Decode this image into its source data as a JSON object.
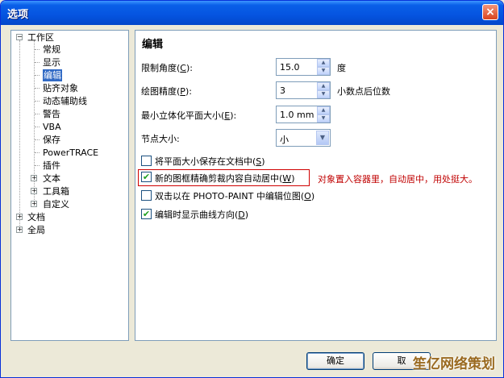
{
  "window": {
    "title": "选项",
    "close_glyph": "×"
  },
  "tree": {
    "workspace": "工作区",
    "workspace_children": [
      "常规",
      "显示",
      "编辑",
      "贴齐对象",
      "动态辅助线",
      "警告",
      "VBA",
      "保存",
      "PowerTRACE",
      "插件"
    ],
    "text": "文本",
    "toolbox": "工具箱",
    "customize": "自定义",
    "document": "文档",
    "global": "全局",
    "selected": "编辑"
  },
  "panel": {
    "heading": "编辑",
    "constrain_angle": {
      "label": "限制角度(",
      "key": "C",
      "label_end": "):",
      "value": "15.0",
      "unit": "度"
    },
    "draw_precision": {
      "label": "绘图精度(",
      "key": "P",
      "label_end": "):",
      "value": "3",
      "unit": "小数点后位数"
    },
    "min_extrude": {
      "label": "最小立体化平面大小(",
      "key": "E",
      "label_end": "):",
      "value": "1.0 mm"
    },
    "node_size": {
      "label": "节点大小:",
      "value": "小"
    },
    "save_face_size": {
      "label": "将平面大小保存在文档中(",
      "key": "S",
      "label_end": ")",
      "checked": false
    },
    "center_powerclip": {
      "label": "新的图框精确剪裁内容自动居中(",
      "key": "W",
      "label_end": ")",
      "checked": true
    },
    "photo_paint": {
      "label": "双击以在 PHOTO-PAINT 中编辑位图(",
      "key": "O",
      "label_end": ")",
      "checked": false
    },
    "show_curve_dir": {
      "label": "编辑时显示曲线方向(",
      "key": "D",
      "label_end": ")",
      "checked": true
    },
    "annotation": "对象置入容器里，自动居中，用处挺大。"
  },
  "buttons": {
    "ok": "确定",
    "cancel": "取"
  },
  "watermark": "笙亿网络策划",
  "colors": {
    "title_bar": "#0554e0",
    "selection": "#316ac5",
    "annotation": "#c00000",
    "check": "#21a121"
  }
}
